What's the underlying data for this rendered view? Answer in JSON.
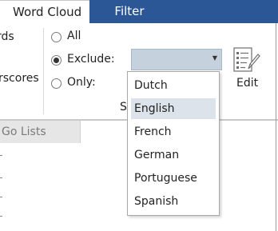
{
  "tabs": {
    "word_cloud": "Word Cloud",
    "filter": "Filter"
  },
  "ribbon": {
    "left_labels": [
      "rds",
      "rscores"
    ],
    "radio_all": "All",
    "radio_exclude": "Exclude:",
    "radio_only": "Only:",
    "selected_option": "exclude",
    "combo_value": "",
    "group_label_partial": "S",
    "edit_label": "Edit"
  },
  "go_lists_tab": "Go Lists",
  "dropdown": {
    "options": [
      "Dutch",
      "English",
      "French",
      "German",
      "Portuguese",
      "Spanish"
    ],
    "highlighted": "English"
  },
  "colors": {
    "tab_bar": "#2b5797",
    "combo_bg": "#c5d1dc",
    "highlight": "#dde3ea"
  }
}
